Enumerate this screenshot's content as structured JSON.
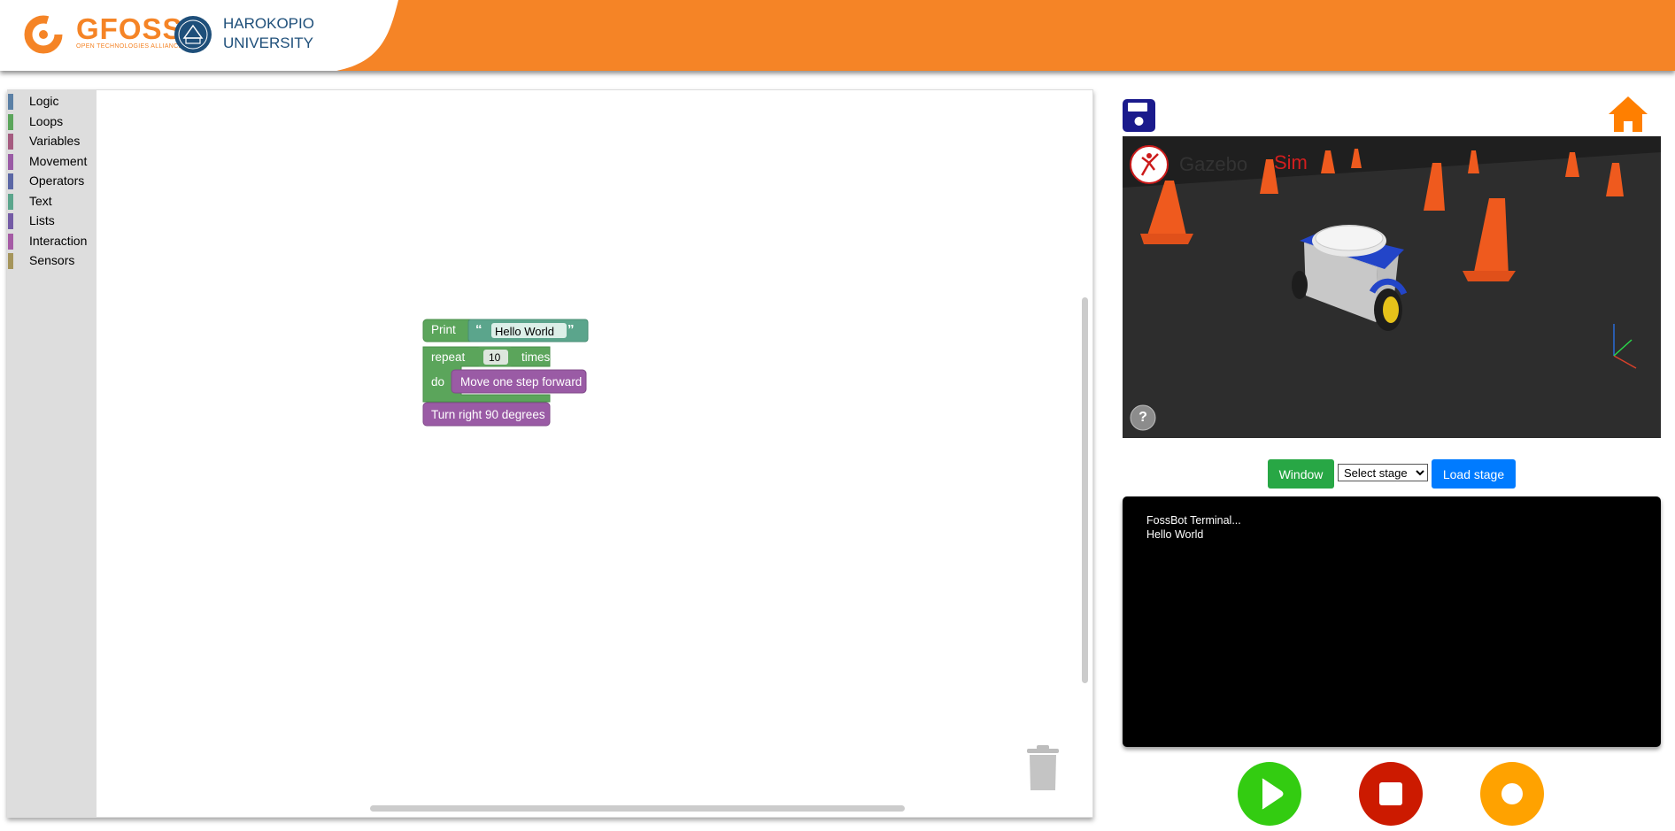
{
  "header": {
    "gfoss_name": "GFOSS",
    "gfoss_tagline": "OPEN TECHNOLOGIES ALLIANCE",
    "university_line1": "HAROKOPIO",
    "university_line2": "UNIVERSITY"
  },
  "toolbox": {
    "categories": [
      {
        "label": "Logic",
        "color": "#5b80a5"
      },
      {
        "label": "Loops",
        "color": "#5ba55b"
      },
      {
        "label": "Variables",
        "color": "#a55b80"
      },
      {
        "label": "Movement",
        "color": "#9a5ba5"
      },
      {
        "label": "Operators",
        "color": "#5b67a5"
      },
      {
        "label": "Text",
        "color": "#5ba58c"
      },
      {
        "label": "Lists",
        "color": "#745ba5"
      },
      {
        "label": "Interaction",
        "color": "#a55ba5"
      },
      {
        "label": "Sensors",
        "color": "#a5955b"
      }
    ]
  },
  "blocks": {
    "print_label": "Print",
    "print_text": "Hello World",
    "repeat_label": "repeat",
    "repeat_count": "10",
    "times_label": "times",
    "do_label": "do",
    "move_label": "Move one step forward",
    "turn_label": "Turn right 90 degrees"
  },
  "simulator": {
    "brand": "Sim",
    "help_label": "?"
  },
  "controls": {
    "window_label": "Window",
    "stage_select_value": "Select stage",
    "load_stage_label": "Load stage"
  },
  "terminal": {
    "lines": [
      "FossBot Terminal...",
      "Hello World"
    ]
  },
  "colors": {
    "header_orange": "#f58426",
    "play": "#33cc11",
    "stop": "#cc1a00",
    "record": "#ffa200",
    "save_icon": "#1a1a8c",
    "home_icon": "#ff7f00"
  }
}
